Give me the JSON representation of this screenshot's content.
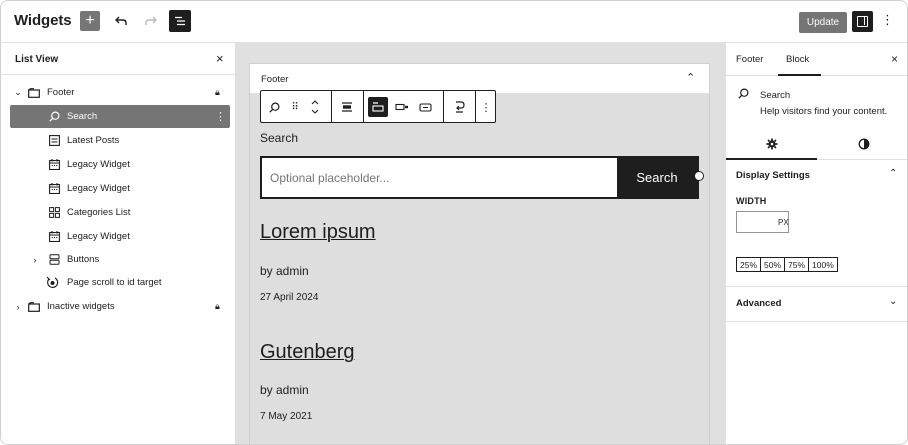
{
  "header": {
    "title": "Widgets",
    "add_icon": "plus-icon",
    "undo_icon": "undo-icon",
    "redo_icon": "redo-icon",
    "list_view_icon": "list-view-icon",
    "update_label": "Update",
    "settings_icon": "sidebar-toggle-icon",
    "options_icon": "vertical-ellipsis-icon"
  },
  "list_view": {
    "title": "List View",
    "items": [
      {
        "label": "Footer",
        "icon": "widget-area-icon",
        "expanded": true,
        "locked": true
      },
      {
        "label": "Search",
        "icon": "search-icon",
        "selected": true
      },
      {
        "label": "Latest Posts",
        "icon": "post-list-icon"
      },
      {
        "label": "Legacy Widget",
        "icon": "calendar-icon"
      },
      {
        "label": "Legacy Widget",
        "icon": "calendar-icon"
      },
      {
        "label": "Categories List",
        "icon": "categories-icon"
      },
      {
        "label": "Legacy Widget",
        "icon": "calendar-icon"
      },
      {
        "label": "Buttons",
        "icon": "buttons-icon",
        "expanded": false
      },
      {
        "label": "Page scroll to id target",
        "icon": "target-icon"
      },
      {
        "label": "Inactive widgets",
        "icon": "widget-area-icon",
        "expanded": false,
        "locked": true
      }
    ]
  },
  "canvas": {
    "area_title": "Footer",
    "search_block": {
      "label": "Search",
      "placeholder": "Optional placeholder...",
      "button_label": "Search"
    },
    "posts": [
      {
        "title": "Lorem ipsum",
        "author": "by admin",
        "date": "27 April 2024"
      },
      {
        "title": "Gutenberg",
        "author": "by admin",
        "date": "7 May 2021"
      }
    ]
  },
  "inspector": {
    "tabs": [
      "Footer",
      "Block"
    ],
    "active_tab": "Block",
    "block_name": "Search",
    "block_description": "Help visitors find your content.",
    "subtabs": [
      "settings-gear-icon",
      "styles-half-circle-icon"
    ],
    "display_settings_title": "Display Settings",
    "width_label": "WIDTH",
    "width_value": "",
    "width_unit": "PX",
    "width_presets": [
      "25%",
      "50%",
      "75%",
      "100%"
    ],
    "advanced_title": "Advanced"
  },
  "colors": {
    "selected_bg": "#757575",
    "dark": "#1e1e1e",
    "canvas_bg": "#e0e0e0"
  }
}
